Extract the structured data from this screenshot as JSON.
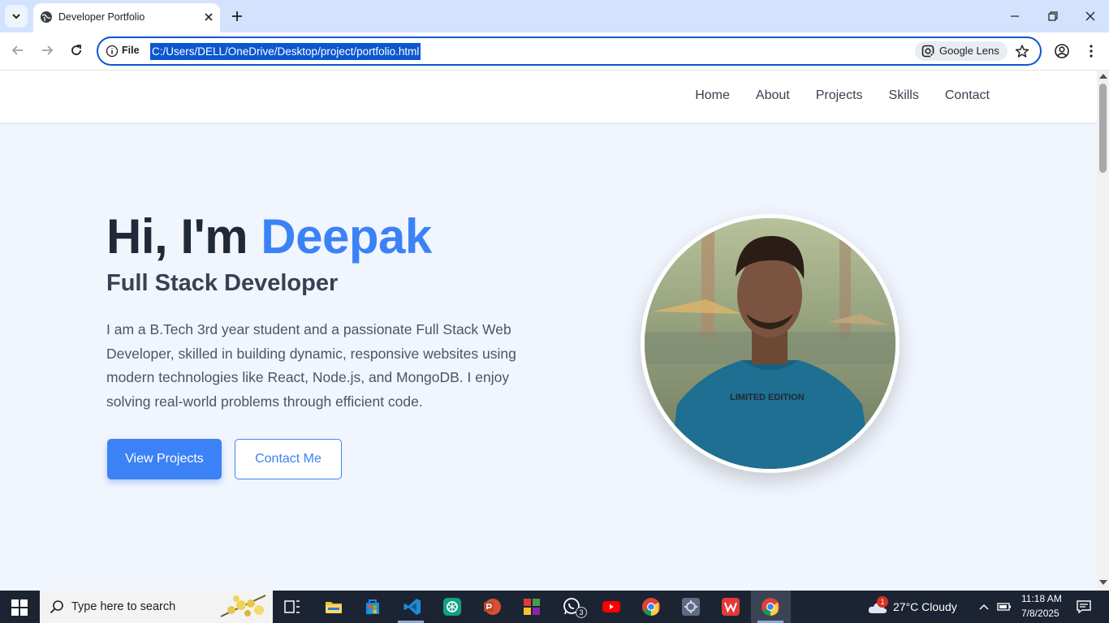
{
  "browser": {
    "tab_title": "Developer Portfolio",
    "chip_label": "File",
    "url": "C:/Users/DELL/OneDrive/Desktop/project/portfolio.html",
    "lens_label": "Google Lens"
  },
  "site": {
    "nav": [
      "Home",
      "About",
      "Projects",
      "Skills",
      "Contact"
    ],
    "greeting": "Hi, I'm ",
    "name": "Deepak",
    "role": "Full Stack Developer",
    "description": "I am a B.Tech 3rd year student and a passionate Full Stack Web Developer, skilled in building dynamic, responsive websites using modern technologies like React, Node.js, and MongoDB. I enjoy solving real-world problems through efficient code.",
    "primary_button": "View Projects",
    "secondary_button": "Contact Me",
    "shirt_text": "LIMITED EDITION",
    "accent_color": "#3b82f6"
  },
  "taskbar": {
    "search_placeholder": "Type here to search",
    "weather": "27°C  Cloudy",
    "weather_badge": "1",
    "whatsapp_badge": "3",
    "time": "11:18 AM",
    "date": "7/8/2025"
  }
}
